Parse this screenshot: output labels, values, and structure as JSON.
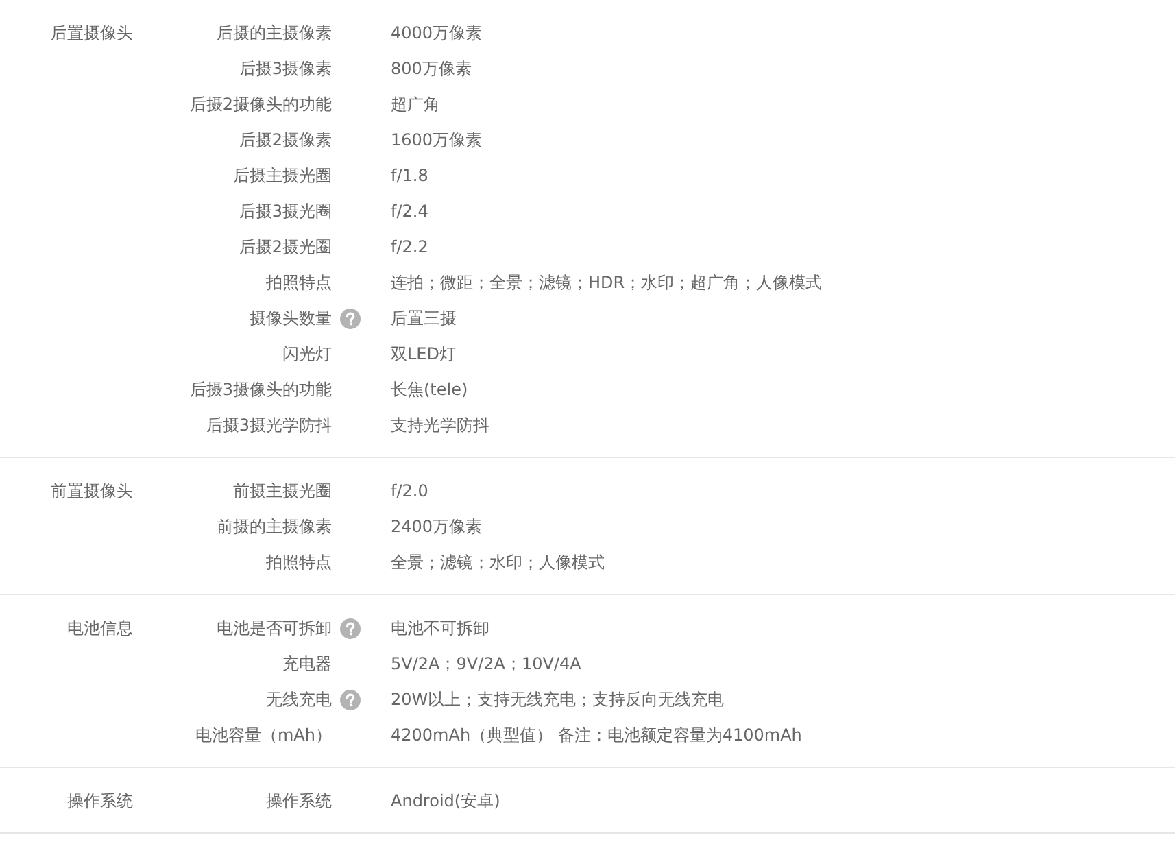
{
  "sections": [
    {
      "title": "后置摄像头",
      "params": [
        {
          "name": "后摄的主摄像素",
          "help": false,
          "value": "4000万像素"
        },
        {
          "name": "后摄3摄像素",
          "help": false,
          "value": "800万像素"
        },
        {
          "name": "后摄2摄像头的功能",
          "help": false,
          "value": "超广角"
        },
        {
          "name": "后摄2摄像素",
          "help": false,
          "value": "1600万像素"
        },
        {
          "name": "后摄主摄光圈",
          "help": false,
          "value": "f/1.8"
        },
        {
          "name": "后摄3摄光圈",
          "help": false,
          "value": "f/2.4"
        },
        {
          "name": "后摄2摄光圈",
          "help": false,
          "value": "f/2.2"
        },
        {
          "name": "拍照特点",
          "help": false,
          "value": "连拍；微距；全景；滤镜；HDR；水印；超广角；人像模式"
        },
        {
          "name": "摄像头数量",
          "help": true,
          "value": "后置三摄"
        },
        {
          "name": "闪光灯",
          "help": false,
          "value": "双LED灯"
        },
        {
          "name": "后摄3摄像头的功能",
          "help": false,
          "value": "长焦(tele)"
        },
        {
          "name": "后摄3摄光学防抖",
          "help": false,
          "value": "支持光学防抖"
        }
      ]
    },
    {
      "title": "前置摄像头",
      "params": [
        {
          "name": "前摄主摄光圈",
          "help": false,
          "value": "f/2.0"
        },
        {
          "name": "前摄的主摄像素",
          "help": false,
          "value": "2400万像素"
        },
        {
          "name": "拍照特点",
          "help": false,
          "value": "全景；滤镜；水印；人像模式"
        }
      ]
    },
    {
      "title": "电池信息",
      "params": [
        {
          "name": "电池是否可拆卸",
          "help": true,
          "value": "电池不可拆卸"
        },
        {
          "name": "充电器",
          "help": false,
          "value": "5V/2A；9V/2A；10V/4A"
        },
        {
          "name": "无线充电",
          "help": true,
          "value": "20W以上；支持无线充电；支持反向无线充电"
        },
        {
          "name": "电池容量（mAh）",
          "help": false,
          "value": "4200mAh（典型值） 备注：电池额定容量为4100mAh"
        }
      ]
    },
    {
      "title": "操作系统",
      "params": [
        {
          "name": "操作系统",
          "help": false,
          "value": "Android(安卓)"
        }
      ]
    }
  ]
}
